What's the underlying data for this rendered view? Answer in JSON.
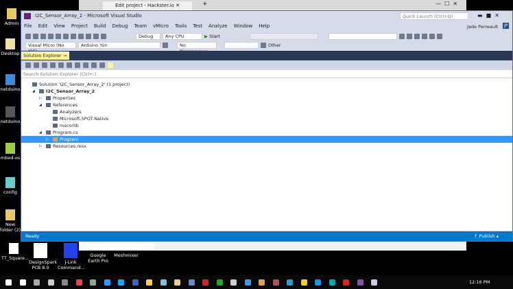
{
  "browser": {
    "tab_title": "Edit project - Hackster.io"
  },
  "desktop_icons": [
    "Admin",
    "Desktop",
    "netduino",
    "netduino",
    "mbed-os",
    "config",
    "New folder (2)",
    "TT_Square...",
    "DesignSpark PCB 8.0",
    "J-Link Command...",
    "Google Earth Pro",
    "Meshmixer"
  ],
  "vs": {
    "title": "I2C_Sensor_Array_2 - Microsoft Visual Studio",
    "quick_launch": "Quick Launch (Ctrl+Q)",
    "user": "Jade Perreault",
    "user_initials": "JP",
    "menu": [
      "File",
      "Edit",
      "View",
      "Project",
      "Build",
      "Debug",
      "Team",
      "vMicro",
      "Tools",
      "Test",
      "Analyze",
      "Window",
      "Help"
    ],
    "toolbar": {
      "config": "Debug",
      "platform": "Any CPU",
      "start": "Start",
      "ide": "Visual Micro (No IDE)",
      "board": "Arduino Yún",
      "programmer": "No Programmer",
      "other": "Other"
    },
    "solution_explorer": {
      "tab": "Solution Explorer",
      "search_placeholder": "Search Solution Explorer (Ctrl+;)",
      "tree": [
        {
          "label": "Solution 'I2C_Sensor_Array_2' (1 project)",
          "depth": 0,
          "arrow": ""
        },
        {
          "label": "I2C_Sensor_Array_2",
          "depth": 1,
          "arrow": "◢",
          "bold": true
        },
        {
          "label": "Properties",
          "depth": 2,
          "arrow": "▷"
        },
        {
          "label": "References",
          "depth": 2,
          "arrow": "◢"
        },
        {
          "label": "Analyzers",
          "depth": 3,
          "arrow": ""
        },
        {
          "label": "Microsoft.SPOT.Native",
          "depth": 3,
          "arrow": ""
        },
        {
          "label": "mscorlib",
          "depth": 3,
          "arrow": ""
        },
        {
          "label": "Program.cs",
          "depth": 2,
          "arrow": "◢"
        },
        {
          "label": "Program",
          "depth": 3,
          "arrow": "▷",
          "selected": true
        },
        {
          "label": "Resources.resx",
          "depth": 2,
          "arrow": "▷"
        }
      ]
    },
    "status": "Ready",
    "publish": "↑ Publish ▴"
  },
  "taskbar": {
    "time": "12:16 PM"
  }
}
